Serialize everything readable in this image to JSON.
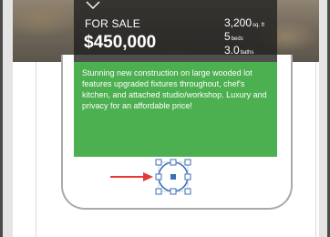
{
  "listing": {
    "status_label": "FOR SALE",
    "price": "$450,000",
    "stats": [
      {
        "value": "3,200",
        "unit": "sq. ft"
      },
      {
        "value": "5",
        "unit": "beds"
      },
      {
        "value": "3.0",
        "unit": "baths"
      }
    ],
    "description": "Stunning new construction on large wooded lot features upgraded fixtures throughout, chef's kitchen, and attached studio/workshop. Luxury and privacy for an affordable price!"
  },
  "colors": {
    "description_panel": "#4caf50",
    "overlay": "#1e1e1e",
    "annotation_arrow": "#e53935",
    "selection_handles": "#3b6fb6"
  },
  "icons": {
    "chevron": "chevron-down-icon",
    "arrow": "red-arrow-icon",
    "selection": "selected-circle-shape"
  }
}
